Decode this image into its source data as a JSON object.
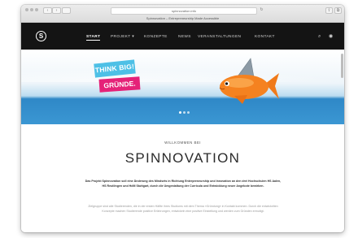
{
  "browser": {
    "url": "spinnovation.info",
    "tab_title": "Spinnovation – Entrepreneurship Made Accessible",
    "back_glyph": "‹",
    "forward_glyph": "›",
    "reload_glyph": "↻",
    "share_glyph": "⇪",
    "tabs_glyph": "⧉"
  },
  "nav": {
    "logo_glyph": "S",
    "items": [
      "START",
      "PROJEKT",
      "KONZEPTE",
      "NEWS",
      "VERANSTALTUNGEN",
      "KONTAKT"
    ],
    "projekt_caret": "▾",
    "search_glyph": "⌕",
    "user_glyph": "◉"
  },
  "hero": {
    "sign1": "THINK BIG!",
    "sign2": "GRÜNDE."
  },
  "content": {
    "welcome": "WILLKOMMEN BEI",
    "title": "SPINNOVATION",
    "para1": "Das Projekt Spinnovation soll eine Änderung des Mindsets in Richtung Entrepreneurship und Innovation an den drei Hochschulen HS Aalen, HS Reutlingen und HdM Stuttgart, durch die Umgestaltung der Curricula und Entwicklung neuer Angebote bewirken.",
    "para2": "Zielgruppe sind alle Studierenden, die in der ersten Hälfte ihres Studiums mit dem Thema »Gründung« in Kontakt kommen. Durch die entwickelten Konzepte machen Studierende positive Erfahrungen, entwickeln eine positive Einstellung und werden zum Gründen ermutigt."
  },
  "colors": {
    "nav_bg": "#141414",
    "accent_cyan": "#4ec0e6",
    "accent_pink": "#e52278",
    "water": "#3b97d3"
  }
}
